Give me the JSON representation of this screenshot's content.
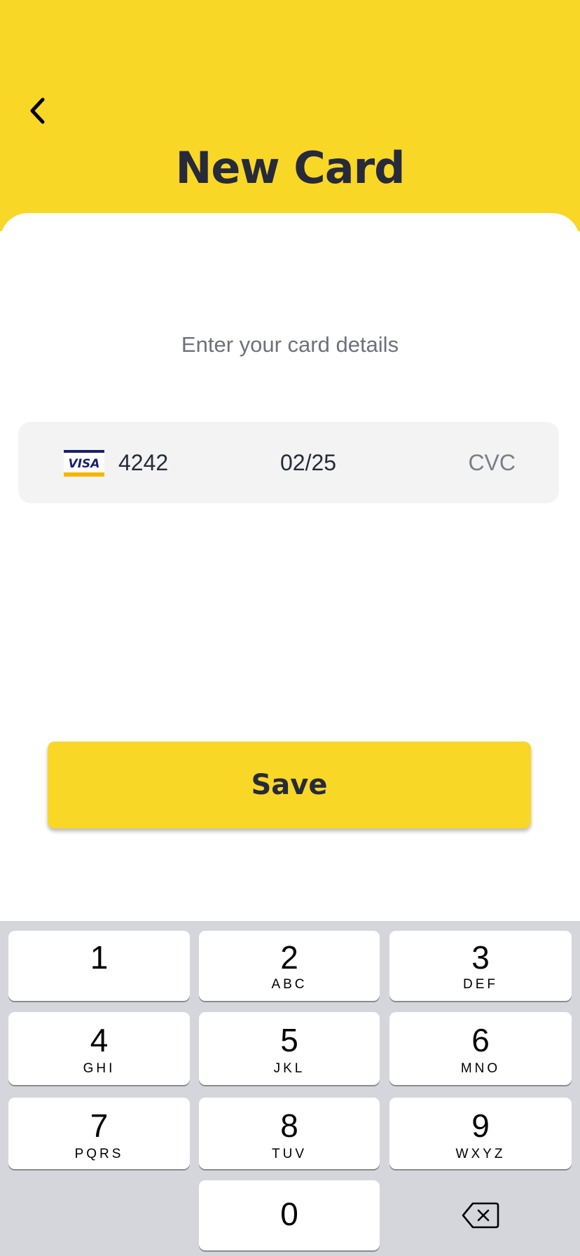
{
  "colors": {
    "accent": "#F9D726",
    "title_text": "#262A3A",
    "field_bg": "#F3F3F4",
    "keyboard_bg": "#D4D6DB"
  },
  "header": {
    "back_icon": "chevron-left-icon",
    "title": "New Card"
  },
  "form": {
    "subtitle": "Enter your card details",
    "card_brand": "VISA",
    "card_number": "4242",
    "expiry": "02/25",
    "cvc_placeholder": "CVC"
  },
  "actions": {
    "save_label": "Save"
  },
  "keypad": {
    "keys": [
      {
        "digit": "1",
        "letters": ""
      },
      {
        "digit": "2",
        "letters": "ABC"
      },
      {
        "digit": "3",
        "letters": "DEF"
      },
      {
        "digit": "4",
        "letters": "GHI"
      },
      {
        "digit": "5",
        "letters": "JKL"
      },
      {
        "digit": "6",
        "letters": "MNO"
      },
      {
        "digit": "7",
        "letters": "PQRS"
      },
      {
        "digit": "8",
        "letters": "TUV"
      },
      {
        "digit": "9",
        "letters": "WXYZ"
      },
      {
        "digit": "0",
        "letters": ""
      }
    ],
    "backspace_icon": "backspace-icon"
  }
}
